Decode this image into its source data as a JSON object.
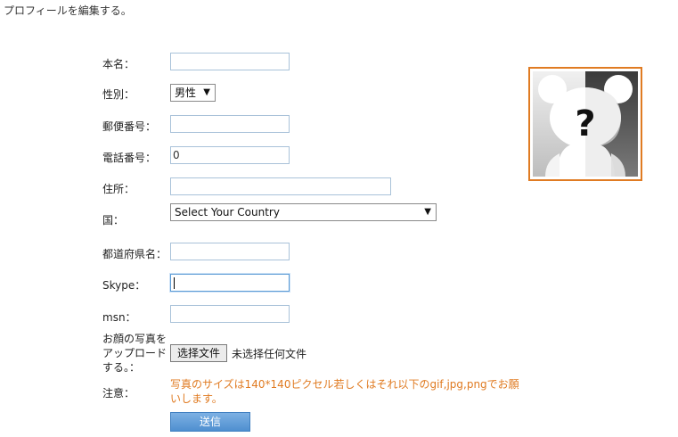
{
  "page": {
    "title": "プロフィールを編集する。"
  },
  "form": {
    "name": {
      "label": "本名：",
      "value": ""
    },
    "gender": {
      "label": "性別：",
      "selected": "男性"
    },
    "postal_code": {
      "label": "郵便番号：",
      "value": ""
    },
    "phone": {
      "label": "電話番号：",
      "value": "0"
    },
    "address": {
      "label": "住所：",
      "value": ""
    },
    "country": {
      "label": "国：",
      "selected": "Select Your Country"
    },
    "prefecture": {
      "label": "都道府県名：",
      "value": ""
    },
    "skype": {
      "label": "Skype：",
      "value": ""
    },
    "msn": {
      "label": "msn：",
      "value": ""
    },
    "photo": {
      "label": "お顔の写真をアップロードする。：",
      "button_label": "选择文件",
      "status": "未选择任何文件"
    },
    "note": {
      "label": "注意：",
      "text": "写真のサイズは140*140ピクセル若しくはそれ以下のgif,jpg,pngでお願いします。"
    },
    "submit_label": "送信"
  },
  "colors": {
    "accent_orange": "#e07b22",
    "button_blue": "#5b9bd5",
    "input_border": "#a9c2d9"
  },
  "icons": {
    "avatar": "mystery-bear-placeholder",
    "select_arrow": "triangle-down"
  }
}
